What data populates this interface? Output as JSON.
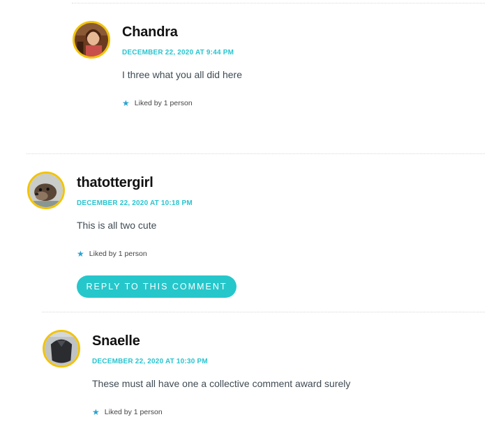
{
  "comments": [
    {
      "author": "Chandra",
      "date": "DECEMBER 22, 2020 AT 9:44 PM",
      "text": "I three what you all did here",
      "likes": "Liked by 1 person"
    },
    {
      "author": "thatottergirl",
      "date": "DECEMBER 22, 2020 AT 10:18 PM",
      "text": "This is all two cute",
      "likes": "Liked by 1 person",
      "reply_label": "REPLY TO THIS COMMENT"
    },
    {
      "author": "Snaelle",
      "date": "DECEMBER 22, 2020 AT 10:30 PM",
      "text": "These must all have one a collective comment award surely",
      "likes": "Liked by 1 person"
    }
  ],
  "colors": {
    "accent": "#27c4cf",
    "avatar_border": "#f2c307",
    "button": "#25c7cb",
    "star": "#2aa3cf"
  },
  "icons": {
    "like": "star-icon"
  }
}
